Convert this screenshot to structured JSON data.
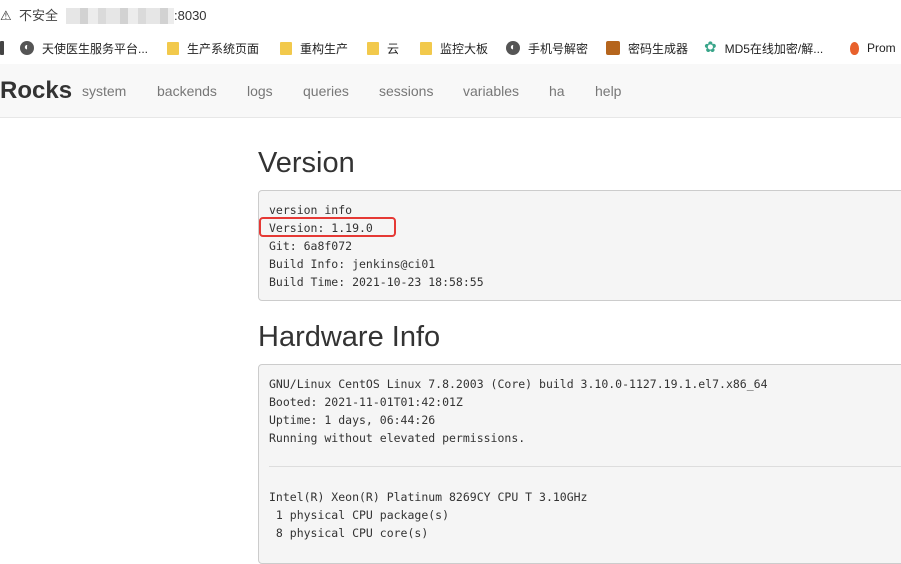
{
  "browser": {
    "security_label": "不安全",
    "url_port": ":8030"
  },
  "bookmarks": [
    {
      "label": "天使医生服务平台...",
      "icon": "globe-icon"
    },
    {
      "label": "生产系统页面",
      "icon": "folder-icon"
    },
    {
      "label": "重构生产",
      "icon": "folder-icon"
    },
    {
      "label": "云",
      "icon": "folder-icon"
    },
    {
      "label": "监控大板",
      "icon": "folder-icon"
    },
    {
      "label": "手机号解密",
      "icon": "globe-icon"
    },
    {
      "label": "密码生成器",
      "icon": "key-icon"
    },
    {
      "label": "MD5在线加密/解...",
      "icon": "gear-icon"
    },
    {
      "label": "Prom",
      "icon": "flame-icon"
    }
  ],
  "nav": {
    "brand": "Rocks",
    "items": [
      "system",
      "backends",
      "logs",
      "queries",
      "sessions",
      "variables",
      "ha",
      "help"
    ]
  },
  "version": {
    "title": "Version",
    "lines": [
      "version info",
      "Version: 1.19.0",
      "Git: 6a8f072",
      "Build Info: jenkins@ci01",
      "Build Time: 2021-10-23 18:58:55"
    ]
  },
  "hardware": {
    "title": "Hardware Info",
    "os_lines": [
      "GNU/Linux CentOS Linux 7.8.2003 (Core) build 3.10.0-1127.19.1.el7.x86_64",
      "Booted: 2021-11-01T01:42:01Z",
      "Uptime: 1 days, 06:44:26",
      "Running without elevated permissions."
    ],
    "cpu_lines": [
      "Intel(R) Xeon(R) Platinum 8269CY CPU T 3.10GHz",
      " 1 physical CPU package(s)",
      " 8 physical CPU core(s)"
    ]
  },
  "colors": {
    "highlight": "#e53935",
    "navbar_bg": "#f8f8f8",
    "panel_bg": "#f5f5f5"
  }
}
